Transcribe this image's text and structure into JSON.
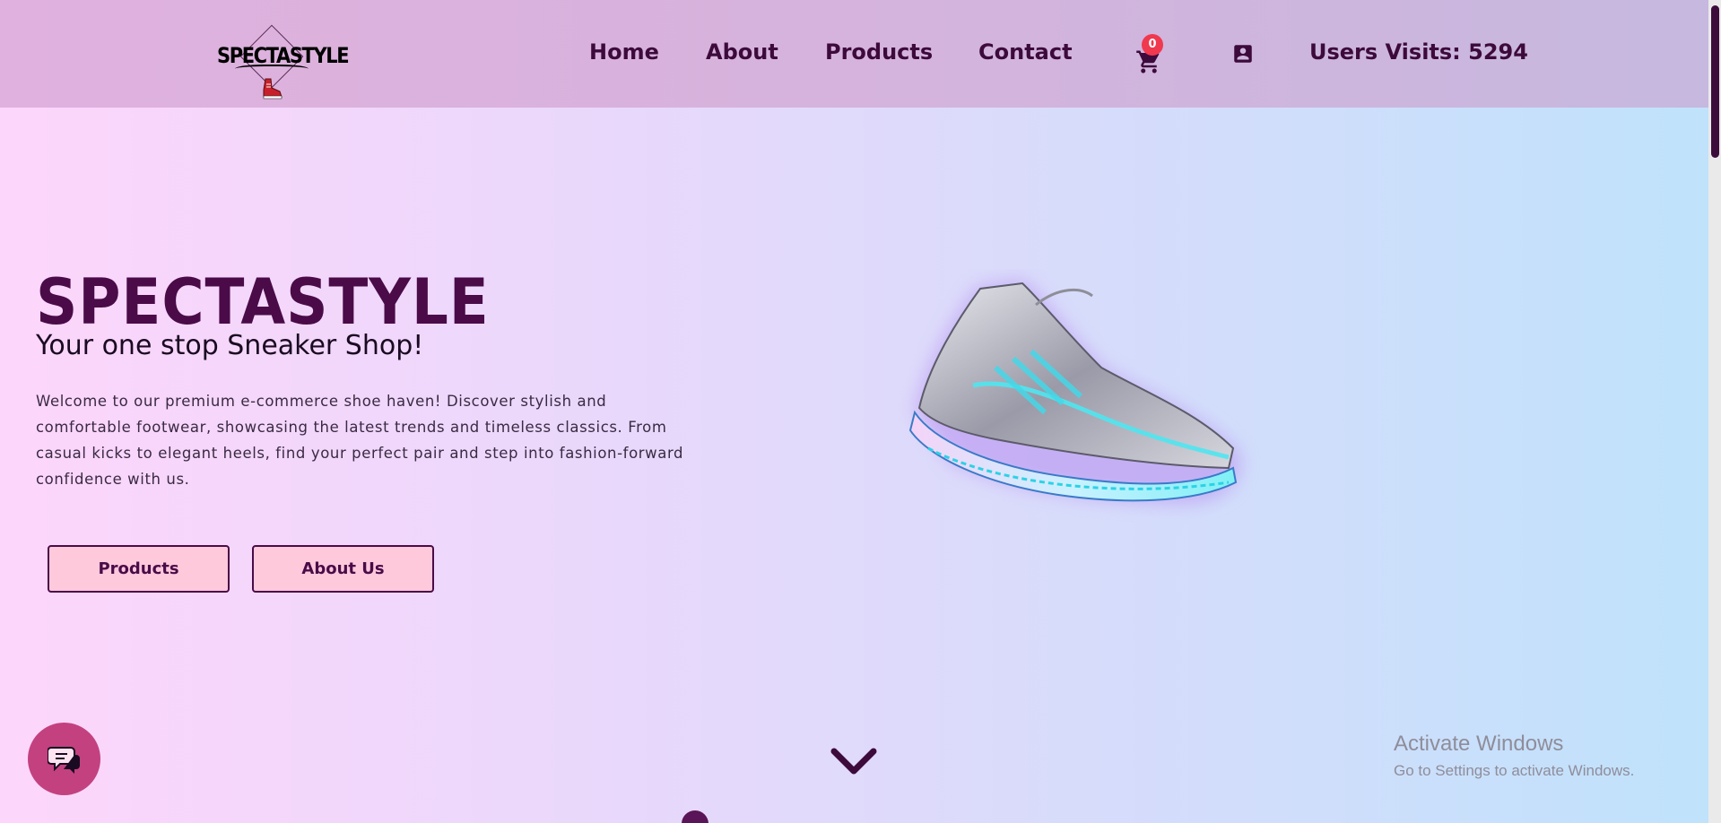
{
  "header": {
    "logo_text": "SPECTASTYLE",
    "logo_script": "sneakers",
    "nav": [
      {
        "label": "Home"
      },
      {
        "label": "About"
      },
      {
        "label": "Products"
      },
      {
        "label": "Contact"
      }
    ],
    "cart_count": "0",
    "cart_icon": "cart-icon",
    "profile_icon": "account-box-icon",
    "visits": "Users Visits: 5294"
  },
  "hero": {
    "title": "SPECTASTYLE",
    "subtitle": "Your one stop Sneaker Shop!",
    "description": "Welcome to our premium e-commerce shoe haven! Discover stylish and comfortable footwear, showcasing the latest trends and timeless classics. From casual kicks to elegant heels, find your perfect pair and step into fashion-forward confidence with us.",
    "buttons": {
      "products": "Products",
      "about": "About Us"
    },
    "image": "glowing-sneaker"
  },
  "scroll_hint_icon": "chevron-down-icon",
  "chat_icon": "chat-bubbles-icon",
  "watermark": {
    "line1": "Activate Windows",
    "line2": "Go to Settings to activate Windows."
  },
  "colors": {
    "primary": "#4a0b48",
    "button_bg": "#ffc9dc",
    "chat_bg": "#c3417f",
    "badge": "#f0384e"
  }
}
